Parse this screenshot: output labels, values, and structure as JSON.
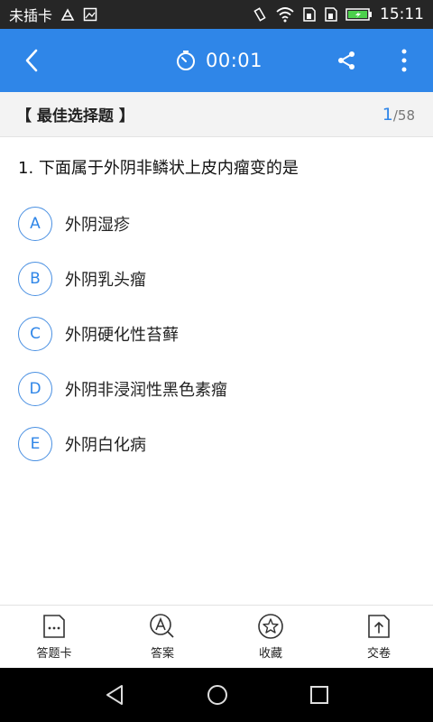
{
  "status_bar": {
    "carrier": "未插卡",
    "time": "15:11"
  },
  "app_bar": {
    "timer": "00:01"
  },
  "section": {
    "title": "【 最佳选择题 】",
    "current": "1",
    "total": "/58"
  },
  "question": {
    "text": "1. 下面属于外阴非鳞状上皮内瘤变的是",
    "options": [
      {
        "letter": "A",
        "text": "外阴湿疹"
      },
      {
        "letter": "B",
        "text": "外阴乳头瘤"
      },
      {
        "letter": "C",
        "text": "外阴硬化性苔藓"
      },
      {
        "letter": "D",
        "text": "外阴非浸润性黑色素瘤"
      },
      {
        "letter": "E",
        "text": "外阴白化病"
      }
    ]
  },
  "bottom_tabs": [
    {
      "label": "答题卡",
      "icon": "answer-card-icon"
    },
    {
      "label": "答案",
      "icon": "answer-icon"
    },
    {
      "label": "收藏",
      "icon": "star-icon"
    },
    {
      "label": "交卷",
      "icon": "submit-icon"
    }
  ],
  "colors": {
    "primary": "#2f86e8",
    "status_bar": "#262626",
    "section_bg": "#f3f3f3"
  }
}
